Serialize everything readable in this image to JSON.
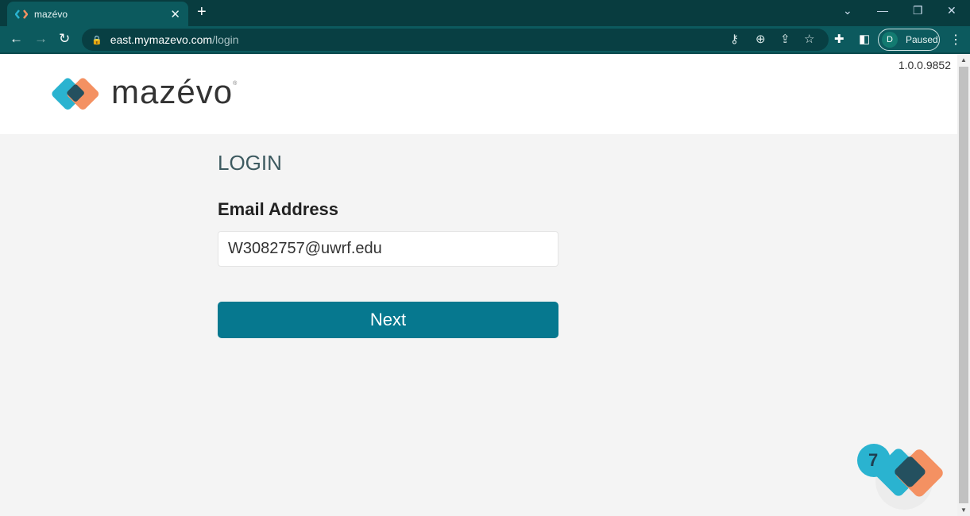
{
  "browser": {
    "tab_title": "mazévo",
    "url_host": "east.mymazevo.com",
    "url_path": "/login",
    "profile_initial": "D",
    "profile_status": "Paused"
  },
  "header": {
    "brand": "mazévo",
    "version": "1.0.0.9852"
  },
  "form": {
    "title": "LOGIN",
    "email_label": "Email Address",
    "email_value": "W3082757@uwrf.edu",
    "next_label": "Next"
  },
  "widget": {
    "badge_count": "7"
  },
  "colors": {
    "accent": "#06788f",
    "logo_blue": "#2ab3d0",
    "logo_orange": "#f49162",
    "logo_dark": "#24505f"
  }
}
